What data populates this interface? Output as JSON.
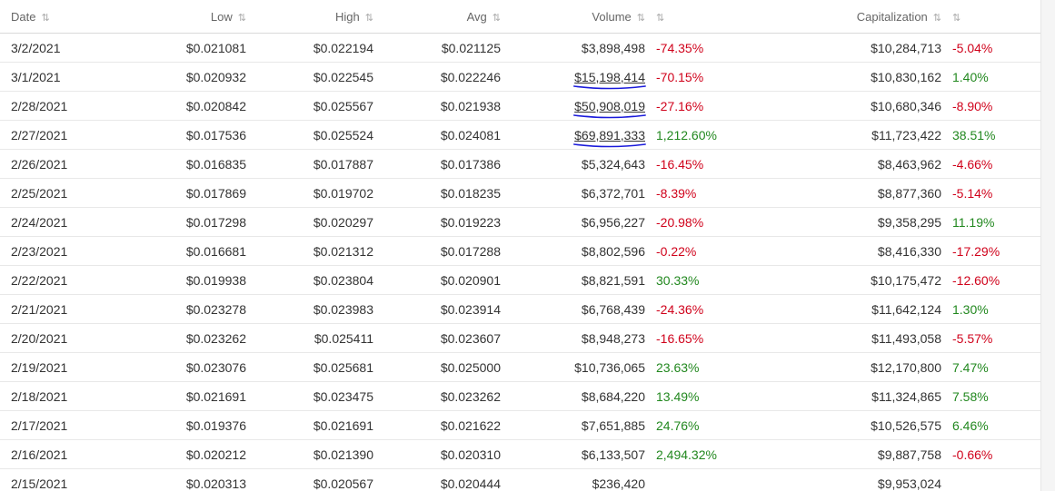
{
  "headers": {
    "date": "Date",
    "low": "Low",
    "high": "High",
    "avg": "Avg",
    "volume": "Volume",
    "capitalization": "Capitalization"
  },
  "icons": {
    "sort": "sort-arrows-icon"
  },
  "colors": {
    "negative": "#d0021b",
    "positive": "#22881f",
    "marker": "#1a1adb"
  },
  "rows": [
    {
      "date": "3/2/2021",
      "low": "$0.021081",
      "high": "$0.022194",
      "avg": "$0.021125",
      "volume": "$3,898,498",
      "volume_change": "-74.35%",
      "volume_dir": "neg",
      "cap": "$10,284,713",
      "cap_change": "-5.04%",
      "cap_dir": "neg",
      "highlighted": false
    },
    {
      "date": "3/1/2021",
      "low": "$0.020932",
      "high": "$0.022545",
      "avg": "$0.022246",
      "volume": "$15,198,414",
      "volume_change": "-70.15%",
      "volume_dir": "neg",
      "cap": "$10,830,162",
      "cap_change": "1.40%",
      "cap_dir": "pos",
      "highlighted": true
    },
    {
      "date": "2/28/2021",
      "low": "$0.020842",
      "high": "$0.025567",
      "avg": "$0.021938",
      "volume": "$50,908,019",
      "volume_change": "-27.16%",
      "volume_dir": "neg",
      "cap": "$10,680,346",
      "cap_change": "-8.90%",
      "cap_dir": "neg",
      "highlighted": true
    },
    {
      "date": "2/27/2021",
      "low": "$0.017536",
      "high": "$0.025524",
      "avg": "$0.024081",
      "volume": "$69,891,333",
      "volume_change": "1,212.60%",
      "volume_dir": "pos",
      "cap": "$11,723,422",
      "cap_change": "38.51%",
      "cap_dir": "pos",
      "highlighted": true
    },
    {
      "date": "2/26/2021",
      "low": "$0.016835",
      "high": "$0.017887",
      "avg": "$0.017386",
      "volume": "$5,324,643",
      "volume_change": "-16.45%",
      "volume_dir": "neg",
      "cap": "$8,463,962",
      "cap_change": "-4.66%",
      "cap_dir": "neg",
      "highlighted": false
    },
    {
      "date": "2/25/2021",
      "low": "$0.017869",
      "high": "$0.019702",
      "avg": "$0.018235",
      "volume": "$6,372,701",
      "volume_change": "-8.39%",
      "volume_dir": "neg",
      "cap": "$8,877,360",
      "cap_change": "-5.14%",
      "cap_dir": "neg",
      "highlighted": false
    },
    {
      "date": "2/24/2021",
      "low": "$0.017298",
      "high": "$0.020297",
      "avg": "$0.019223",
      "volume": "$6,956,227",
      "volume_change": "-20.98%",
      "volume_dir": "neg",
      "cap": "$9,358,295",
      "cap_change": "11.19%",
      "cap_dir": "pos",
      "highlighted": false
    },
    {
      "date": "2/23/2021",
      "low": "$0.016681",
      "high": "$0.021312",
      "avg": "$0.017288",
      "volume": "$8,802,596",
      "volume_change": "-0.22%",
      "volume_dir": "neg",
      "cap": "$8,416,330",
      "cap_change": "-17.29%",
      "cap_dir": "neg",
      "highlighted": false
    },
    {
      "date": "2/22/2021",
      "low": "$0.019938",
      "high": "$0.023804",
      "avg": "$0.020901",
      "volume": "$8,821,591",
      "volume_change": "30.33%",
      "volume_dir": "pos",
      "cap": "$10,175,472",
      "cap_change": "-12.60%",
      "cap_dir": "neg",
      "highlighted": false
    },
    {
      "date": "2/21/2021",
      "low": "$0.023278",
      "high": "$0.023983",
      "avg": "$0.023914",
      "volume": "$6,768,439",
      "volume_change": "-24.36%",
      "volume_dir": "neg",
      "cap": "$11,642,124",
      "cap_change": "1.30%",
      "cap_dir": "pos",
      "highlighted": false
    },
    {
      "date": "2/20/2021",
      "low": "$0.023262",
      "high": "$0.025411",
      "avg": "$0.023607",
      "volume": "$8,948,273",
      "volume_change": "-16.65%",
      "volume_dir": "neg",
      "cap": "$11,493,058",
      "cap_change": "-5.57%",
      "cap_dir": "neg",
      "highlighted": false
    },
    {
      "date": "2/19/2021",
      "low": "$0.023076",
      "high": "$0.025681",
      "avg": "$0.025000",
      "volume": "$10,736,065",
      "volume_change": "23.63%",
      "volume_dir": "pos",
      "cap": "$12,170,800",
      "cap_change": "7.47%",
      "cap_dir": "pos",
      "highlighted": false
    },
    {
      "date": "2/18/2021",
      "low": "$0.021691",
      "high": "$0.023475",
      "avg": "$0.023262",
      "volume": "$8,684,220",
      "volume_change": "13.49%",
      "volume_dir": "pos",
      "cap": "$11,324,865",
      "cap_change": "7.58%",
      "cap_dir": "pos",
      "highlighted": false
    },
    {
      "date": "2/17/2021",
      "low": "$0.019376",
      "high": "$0.021691",
      "avg": "$0.021622",
      "volume": "$7,651,885",
      "volume_change": "24.76%",
      "volume_dir": "pos",
      "cap": "$10,526,575",
      "cap_change": "6.46%",
      "cap_dir": "pos",
      "highlighted": false
    },
    {
      "date": "2/16/2021",
      "low": "$0.020212",
      "high": "$0.021390",
      "avg": "$0.020310",
      "volume": "$6,133,507",
      "volume_change": "2,494.32%",
      "volume_dir": "pos",
      "cap": "$9,887,758",
      "cap_change": "-0.66%",
      "cap_dir": "neg",
      "highlighted": false
    },
    {
      "date": "2/15/2021",
      "low": "$0.020313",
      "high": "$0.020567",
      "avg": "$0.020444",
      "volume": "$236,420",
      "volume_change": "",
      "volume_dir": "",
      "cap": "$9,953,024",
      "cap_change": "",
      "cap_dir": "",
      "highlighted": false
    }
  ]
}
